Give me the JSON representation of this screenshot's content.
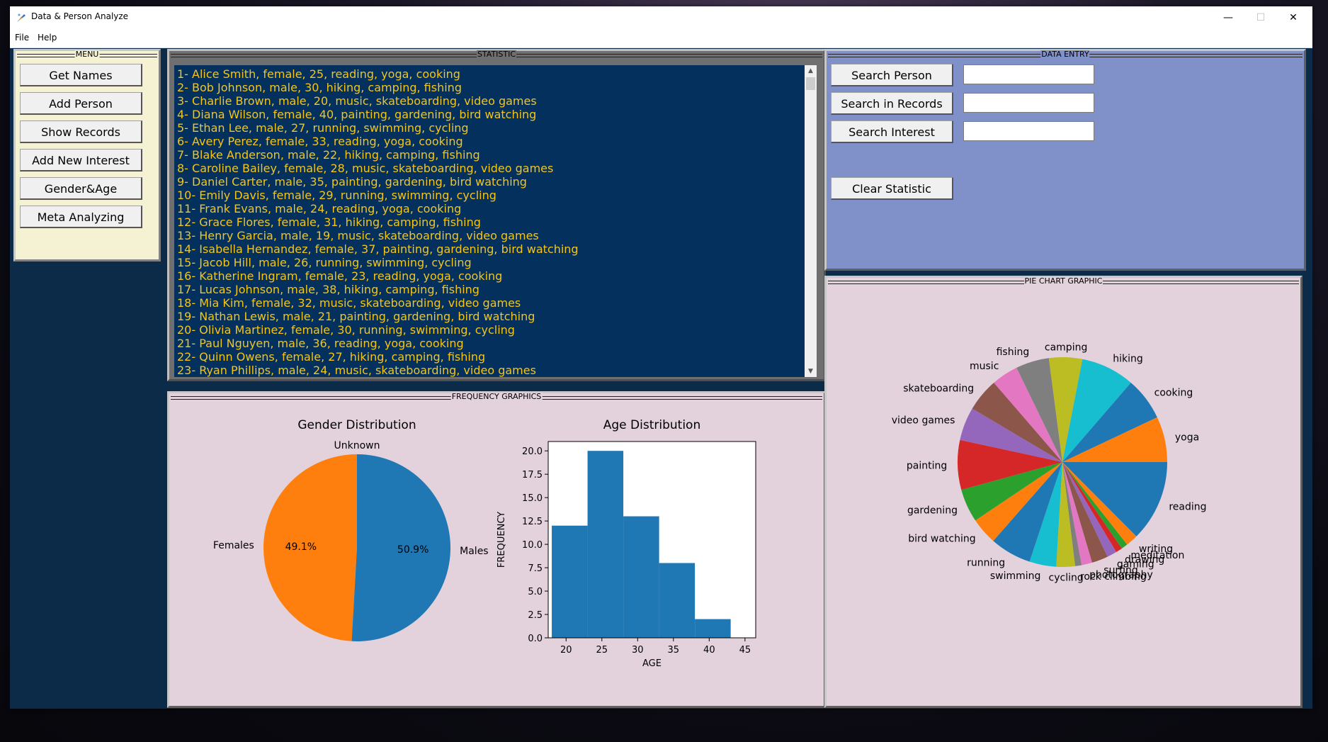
{
  "window": {
    "title": "Data & Person Analyze",
    "minimize": "—",
    "maximize": "☐",
    "close": "✕"
  },
  "menubar": {
    "file": "File",
    "help": "Help"
  },
  "menu_panel": {
    "title": "MENU",
    "buttons": [
      "Get Names",
      "Add Person",
      "Show Records",
      "Add New Interest",
      "Gender&Age Analysis",
      "Meta Analyzing"
    ]
  },
  "statistic_panel": {
    "title": "STATISTIC",
    "records": [
      "1- Alice Smith, female, 25, reading, yoga, cooking",
      "2- Bob Johnson, male, 30, hiking, camping, fishing",
      "3- Charlie Brown, male, 20, music, skateboarding, video games",
      "4- Diana Wilson, female, 40, painting, gardening, bird watching",
      "5- Ethan Lee, male, 27, running, swimming, cycling",
      "6- Avery Perez, female, 33, reading, yoga, cooking",
      "7- Blake Anderson, male, 22, hiking, camping, fishing",
      "8- Caroline Bailey, female, 28, music, skateboarding, video games",
      "9- Daniel Carter, male, 35, painting, gardening, bird watching",
      "10- Emily Davis, female, 29, running, swimming, cycling",
      "11- Frank Evans, male, 24, reading, yoga, cooking",
      "12- Grace Flores, female, 31, hiking, camping, fishing",
      "13- Henry Garcia, male, 19, music, skateboarding, video games",
      "14- Isabella Hernandez, female, 37, painting, gardening, bird watching",
      "15- Jacob Hill, male, 26, running, swimming, cycling",
      "16- Katherine Ingram, female, 23, reading, yoga, cooking",
      "17- Lucas Johnson, male, 38, hiking, camping, fishing",
      "18- Mia Kim, female, 32, music, skateboarding, video games",
      "19- Nathan Lewis, male, 21, painting, gardening, bird watching",
      "20- Olivia Martinez, female, 30, running, swimming, cycling",
      "21- Paul Nguyen, male, 36, reading, yoga, cooking",
      "22- Quinn Owens, female, 27, hiking, camping, fishing",
      "23- Ryan Phillips, male, 24, music, skateboarding, video games"
    ]
  },
  "data_entry_panel": {
    "title": "DATA ENTRY",
    "search_person": "Search Person",
    "search_records": "Search in Records",
    "search_interest": "Search Interest",
    "clear_statistic": "Clear Statistic",
    "search_person_value": "",
    "search_records_value": "",
    "search_interest_value": ""
  },
  "frequency_panel": {
    "title": "FREQUENCY GRAPHICS"
  },
  "pie_panel": {
    "title": "PIE CHART GRAPHIC"
  },
  "colors": {
    "tab_blue": "#1f77b4",
    "tab_orange": "#ff7f0e",
    "tab_green": "#2ca02c",
    "tab_red": "#d62728",
    "tab_purple": "#9467bd",
    "tab_brown": "#8c564b",
    "tab_pink": "#e377c2",
    "tab_gray": "#7f7f7f",
    "tab_olive": "#bcbd22",
    "tab_cyan": "#17becf",
    "record_text": "#f5c518"
  },
  "chart_data": [
    {
      "type": "pie",
      "title": "Gender Distribution",
      "labels": [
        "Unknown",
        "Females",
        "Males"
      ],
      "values": [
        0.0,
        49.1,
        50.9
      ],
      "percent_labels": [
        "0.0%",
        "49.1%",
        "50.9%"
      ]
    },
    {
      "type": "bar",
      "title": "Age Distribution",
      "xlabel": "AGE",
      "ylabel": "FREQUENCY",
      "bins": [
        [
          18,
          23
        ],
        [
          23,
          28
        ],
        [
          28,
          33
        ],
        [
          33,
          38
        ],
        [
          38,
          43
        ]
      ],
      "values": [
        12,
        20,
        13,
        8,
        2
      ],
      "xlim": [
        17.5,
        46.5
      ],
      "ylim": [
        0,
        21
      ],
      "xticks": [
        "20",
        "25",
        "30",
        "35",
        "40",
        "45"
      ],
      "yticks": [
        "0.0",
        "2.5",
        "5.0",
        "7.5",
        "10.0",
        "12.5",
        "15.0",
        "17.5",
        "20.0"
      ]
    },
    {
      "type": "pie",
      "labels": [
        "reading",
        "writing",
        "meditation",
        "drawing",
        "gaming",
        "surfing",
        "photography",
        "rock climbing",
        "cycling",
        "swimming",
        "running",
        "bird watching",
        "gardening",
        "painting",
        "video games",
        "skateboarding",
        "music",
        "fishing",
        "camping",
        "hiking",
        "cooking",
        "yoga"
      ],
      "values": [
        10,
        1.5,
        0.8,
        0.8,
        1.2,
        2.0,
        1.3,
        0.8,
        2.3,
        3.3,
        5.1,
        3.3,
        4.1,
        6.1,
        4.1,
        4.1,
        3.3,
        4.1,
        4.1,
        6.6,
        5.3,
        5.6
      ]
    }
  ]
}
